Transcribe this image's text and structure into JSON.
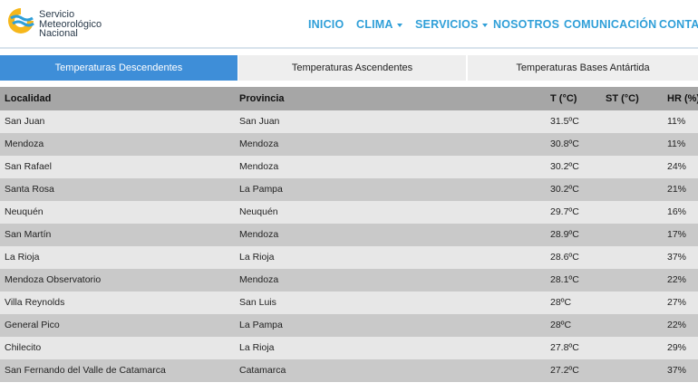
{
  "brand": {
    "line1": "Servicio",
    "line2": "Meteorológico",
    "line3": "Nacional",
    "colors": {
      "yellow": "#f6b71b",
      "blue": "#2f9fd8"
    }
  },
  "nav": [
    {
      "label": "INICIO",
      "dropdown": false
    },
    {
      "label": "CLIMA",
      "dropdown": true
    },
    {
      "label": "SERVICIOS",
      "dropdown": true
    },
    {
      "label": "NOSOTROS",
      "dropdown": false
    },
    {
      "label": "COMUNICACIÓN",
      "dropdown": false
    },
    {
      "label": "CONTA",
      "dropdown": false
    }
  ],
  "tabs": [
    {
      "label": "Temperaturas Descendentes",
      "active": true
    },
    {
      "label": "Temperaturas Ascendentes",
      "active": false
    },
    {
      "label": "Temperaturas Bases Antártida",
      "active": false
    }
  ],
  "table": {
    "headers": {
      "localidad": "Localidad",
      "provincia": "Provincia",
      "t": "T (°C)",
      "st": "ST (°C)",
      "hr": "HR (%)"
    },
    "rows": [
      {
        "localidad": "San Juan",
        "provincia": "San Juan",
        "t": "31.5ºC",
        "st": "",
        "hr": "11%"
      },
      {
        "localidad": "Mendoza",
        "provincia": "Mendoza",
        "t": "30.8ºC",
        "st": "",
        "hr": "11%"
      },
      {
        "localidad": "San Rafael",
        "provincia": "Mendoza",
        "t": "30.2ºC",
        "st": "",
        "hr": "24%"
      },
      {
        "localidad": "Santa Rosa",
        "provincia": "La Pampa",
        "t": "30.2ºC",
        "st": "",
        "hr": "21%"
      },
      {
        "localidad": "Neuquén",
        "provincia": "Neuquén",
        "t": "29.7ºC",
        "st": "",
        "hr": "16%"
      },
      {
        "localidad": "San Martín",
        "provincia": "Mendoza",
        "t": "28.9ºC",
        "st": "",
        "hr": "17%"
      },
      {
        "localidad": "La Rioja",
        "provincia": "La Rioja",
        "t": "28.6ºC",
        "st": "",
        "hr": "37%"
      },
      {
        "localidad": "Mendoza Observatorio",
        "provincia": "Mendoza",
        "t": "28.1ºC",
        "st": "",
        "hr": "22%"
      },
      {
        "localidad": "Villa Reynolds",
        "provincia": "San Luis",
        "t": "28ºC",
        "st": "",
        "hr": "27%"
      },
      {
        "localidad": "General Pico",
        "provincia": "La Pampa",
        "t": "28ºC",
        "st": "",
        "hr": "22%"
      },
      {
        "localidad": "Chilecito",
        "provincia": "La Rioja",
        "t": "27.8ºC",
        "st": "",
        "hr": "29%"
      },
      {
        "localidad": "San Fernando del Valle de Catamarca",
        "provincia": "Catamarca",
        "t": "27.2ºC",
        "st": "",
        "hr": "37%"
      }
    ]
  }
}
